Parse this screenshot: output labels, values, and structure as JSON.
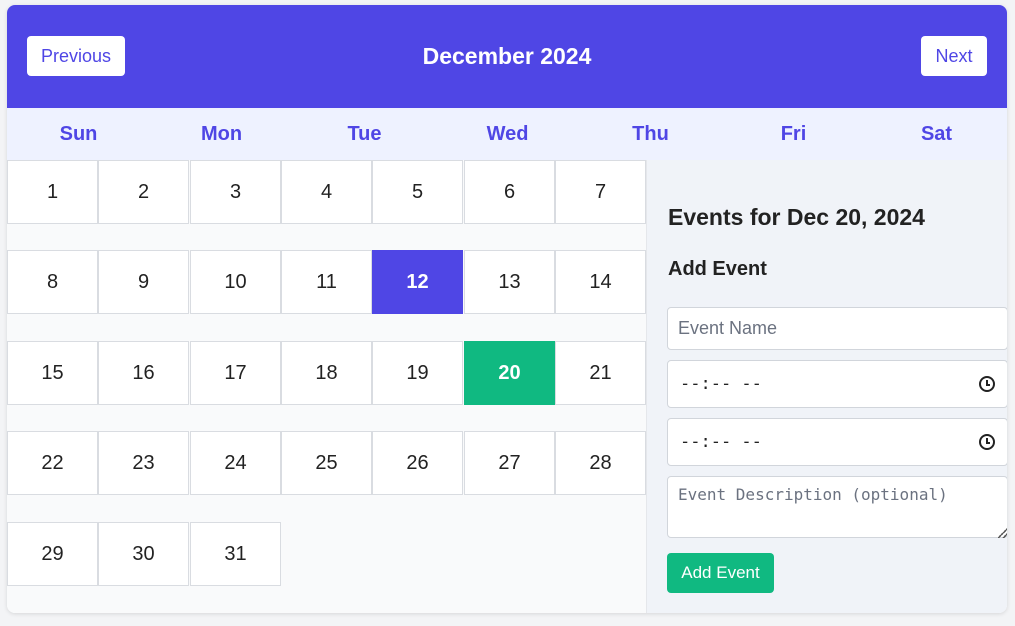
{
  "header": {
    "title": "December 2024",
    "prev_label": "Previous",
    "next_label": "Next"
  },
  "weekdays": [
    "Sun",
    "Mon",
    "Tue",
    "Wed",
    "Thu",
    "Fri",
    "Sat"
  ],
  "calendar": {
    "today": 12,
    "selected": 20,
    "weeks": [
      [
        1,
        2,
        3,
        4,
        5,
        6,
        7
      ],
      [
        8,
        9,
        10,
        11,
        12,
        13,
        14
      ],
      [
        15,
        16,
        17,
        18,
        19,
        20,
        21
      ],
      [
        22,
        23,
        24,
        25,
        26,
        27,
        28
      ],
      [
        29,
        30,
        31
      ]
    ]
  },
  "panel": {
    "title": "Events for Dec 20, 2024",
    "add_heading": "Add Event",
    "name_placeholder": "Event Name",
    "start_time_value": "--:-- --",
    "end_time_value": "--:-- --",
    "description_placeholder": "Event Description (optional)",
    "add_button_label": "Add Event"
  },
  "colors": {
    "accent": "#4f46e5",
    "selected": "#10b981",
    "weekday_bg": "#eef2ff",
    "panel_bg": "#f0f3f8"
  },
  "icons": {
    "time_field": "clock-icon",
    "textarea": "resize-handle-icon"
  }
}
